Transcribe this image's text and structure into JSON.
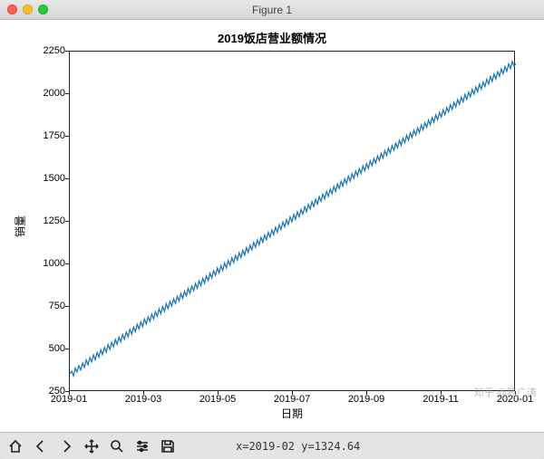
{
  "window": {
    "title": "Figure 1"
  },
  "chart_data": {
    "type": "line",
    "title": "2019饭店营业额情况",
    "xlabel": "日期",
    "ylabel": "销量",
    "ylim": [
      250,
      2250
    ],
    "yticks": [
      250,
      500,
      750,
      1000,
      1250,
      1500,
      1750,
      2000,
      2250
    ],
    "xticks": [
      "2019-01",
      "2019-03",
      "2019-05",
      "2019-07",
      "2019-09",
      "2019-11",
      "2020-01"
    ],
    "x_day_span": 365,
    "series": [
      {
        "name": "销量",
        "values": [
          358,
          372,
          345,
          390,
          368,
          405,
          380,
          420,
          395,
          438,
          410,
          452,
          428,
          468,
          440,
          482,
          455,
          498,
          470,
          512,
          485,
          528,
          500,
          542,
          515,
          558,
          530,
          572,
          545,
          588,
          560,
          602,
          575,
          618,
          590,
          632,
          605,
          648,
          620,
          662,
          635,
          678,
          650,
          692,
          665,
          708,
          680,
          722,
          695,
          738,
          710,
          752,
          725,
          768,
          740,
          782,
          755,
          798,
          770,
          812,
          785,
          828,
          800,
          842,
          815,
          858,
          830,
          872,
          845,
          888,
          860,
          902,
          875,
          918,
          890,
          932,
          905,
          948,
          920,
          962,
          935,
          978,
          950,
          992,
          965,
          1008,
          980,
          1022,
          995,
          1038,
          1010,
          1052,
          1025,
          1068,
          1040,
          1082,
          1055,
          1098,
          1070,
          1112,
          1085,
          1128,
          1100,
          1142,
          1115,
          1158,
          1130,
          1172,
          1145,
          1188,
          1160,
          1202,
          1175,
          1218,
          1190,
          1232,
          1205,
          1248,
          1220,
          1262,
          1235,
          1278,
          1250,
          1292,
          1265,
          1308,
          1280,
          1322,
          1295,
          1338,
          1310,
          1352,
          1325,
          1368,
          1340,
          1382,
          1355,
          1398,
          1370,
          1412,
          1385,
          1428,
          1400,
          1442,
          1415,
          1458,
          1430,
          1472,
          1445,
          1488,
          1460,
          1502,
          1475,
          1518,
          1490,
          1532,
          1505,
          1548,
          1520,
          1562,
          1535,
          1578,
          1550,
          1592,
          1565,
          1608,
          1580,
          1622,
          1595,
          1638,
          1610,
          1652,
          1625,
          1668,
          1640,
          1682,
          1655,
          1698,
          1670,
          1712,
          1685,
          1728,
          1700,
          1742,
          1715,
          1758,
          1730,
          1772,
          1745,
          1788,
          1760,
          1802,
          1775,
          1818,
          1790,
          1832,
          1805,
          1848,
          1820,
          1862,
          1835,
          1878,
          1850,
          1892,
          1865,
          1908,
          1880,
          1922,
          1895,
          1938,
          1910,
          1952,
          1925,
          1968,
          1940,
          1982,
          1955,
          1998,
          1970,
          2012,
          1985,
          2028,
          2000,
          2042,
          2015,
          2058,
          2030,
          2072,
          2045,
          2088,
          2060,
          2102,
          2075,
          2118,
          2090,
          2132,
          2105,
          2148,
          2120,
          2162,
          2135,
          2178,
          2150,
          2192,
          2165,
          2180
        ]
      }
    ]
  },
  "toolbar": {
    "home": "Home",
    "back": "Back",
    "forward": "Forward",
    "pan": "Pan",
    "zoom": "Zoom",
    "config": "Configure",
    "save": "Save"
  },
  "status": {
    "coords": "x=2019-02 y=1324.64"
  },
  "watermark": "知乎 @陈广涛"
}
